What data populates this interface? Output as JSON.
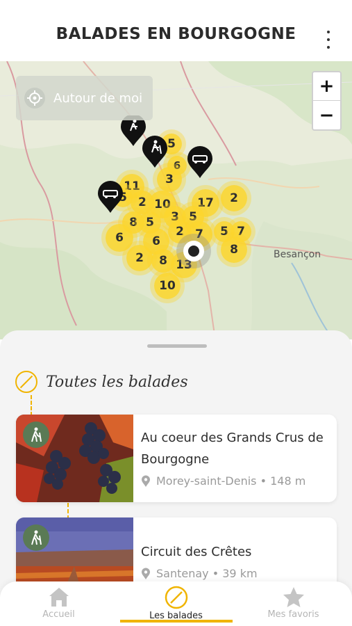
{
  "header": {
    "title": "BALADES EN BOURGOGNE",
    "more_icon": "more-vertical-icon"
  },
  "map": {
    "around_me_label": "Autour de moi",
    "zoom_in_label": "+",
    "zoom_out_label": "−",
    "city_label": "Besançon",
    "clusters": [
      "5",
      "6",
      "3",
      "11",
      "5",
      "2",
      "10",
      "17",
      "2",
      "8",
      "5",
      "3",
      "5",
      "2",
      "7",
      "5",
      "7",
      "6",
      "6",
      "2",
      "8",
      "13",
      "8",
      "10"
    ]
  },
  "section": {
    "title": "Toutes les balades"
  },
  "walks": [
    {
      "title": "Au coeur des Grands Crus de Bourgogne",
      "location": "Morey-saint-Denis",
      "distance": "148 m",
      "meta": "Morey-saint-Denis • 148 m"
    },
    {
      "title": "Circuit des Crêtes",
      "location": "Santenay",
      "distance": "39 km",
      "meta": "Santenay • 39 km"
    }
  ],
  "tabs": [
    {
      "label": "Accueil",
      "icon": "home-icon"
    },
    {
      "label": "Les balades",
      "icon": "compass-icon"
    },
    {
      "label": "Mes favoris",
      "icon": "star-icon"
    }
  ],
  "colors": {
    "accent": "#f0b400",
    "cluster": "#fcd52c",
    "badge": "#5a7a55"
  }
}
